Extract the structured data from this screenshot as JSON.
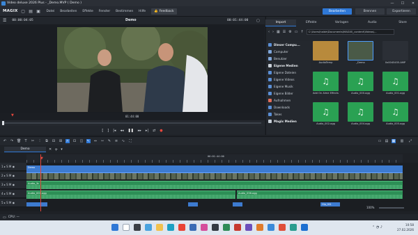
{
  "window": {
    "title": "Video deluxe 2026 Plus - _Demo.MVP ( Demo )",
    "minimize": "—",
    "maximize": "☐",
    "close": "✕"
  },
  "menubar": {
    "logo": "MAGIX",
    "menus": [
      "Datei",
      "Bearbeiten",
      "Effekte",
      "Fenster",
      "Bestimmen",
      "Hilfe"
    ],
    "feedback": "Feedback",
    "modes": [
      "Bearbeiten",
      "Brennen",
      "Exportieren"
    ]
  },
  "preview": {
    "timecode_left": "00:00:04:05",
    "title": "Demo",
    "timecode_right": "00:01:44:00",
    "marker_time": "01:44:00"
  },
  "media_pool": {
    "tabs": [
      "Import",
      "Effekte",
      "Vorlagen",
      "Audio",
      "Store"
    ],
    "path": "C:\\Users\\halde\\Documents\\MAGIX\\_content\\Videos\\...",
    "tree": [
      {
        "label": "Dieser Compu...",
        "header": true,
        "color": "#5b8fd6"
      },
      {
        "label": "Computer",
        "header": false,
        "color": "#7fa6da"
      },
      {
        "label": "Benutzer",
        "header": false,
        "color": "#7fa6da"
      },
      {
        "label": "Eigene Medien",
        "header": true,
        "color": "#c9d0d8"
      },
      {
        "label": "Eigene Dateien",
        "header": false,
        "color": "#5b8fd6"
      },
      {
        "label": "Eigene Videos",
        "header": false,
        "color": "#5b8fd6"
      },
      {
        "label": "Eigene Musik",
        "header": false,
        "color": "#5b8fd6"
      },
      {
        "label": "Eigene Bilder",
        "header": false,
        "color": "#5b8fd6"
      },
      {
        "label": "Aufnahmen",
        "header": false,
        "color": "#e26d5a"
      },
      {
        "label": "Downloads",
        "header": false,
        "color": "#5b8fd6"
      },
      {
        "label": "Takes",
        "header": false,
        "color": "#5b8fd6"
      },
      {
        "label": "Magix Medien",
        "header": true,
        "color": "#c9d0d8"
      }
    ],
    "files": [
      {
        "name": "AudioTemp",
        "kind": "folder"
      },
      {
        "name": "_Demo",
        "kind": "video"
      },
      {
        "name": "0x0045455.AMP",
        "kind": "dark"
      },
      {
        "name": "Add On Alme Effects.ogg",
        "kind": "music"
      },
      {
        "name": "Audio_000.ogg",
        "kind": "music"
      },
      {
        "name": "Audio_001.ogg",
        "kind": "music"
      },
      {
        "name": "Audio_002.ogg",
        "kind": "music"
      },
      {
        "name": "Audio_004.ogg",
        "kind": "music"
      },
      {
        "name": "Audio_005.ogg",
        "kind": "music"
      }
    ]
  },
  "timeline": {
    "project_tab": "Demo",
    "ruler_time": "00:01:44:00",
    "zoom": "100%",
    "clips": [
      "Demo",
      "Audio_3c",
      "Audio_000.ogg",
      "Audio_036.ogg",
      "Clip_001"
    ]
  },
  "statusbar": {
    "cpu": "CPU: —"
  },
  "taskbar": {
    "time": "10:58",
    "date": "27.02.2026"
  }
}
